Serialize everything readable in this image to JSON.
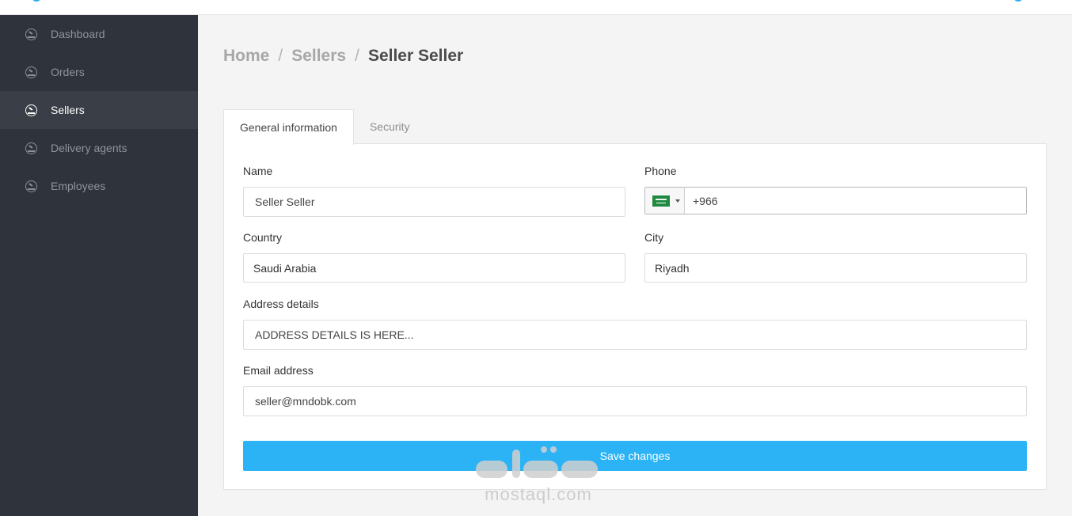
{
  "sidebar": {
    "items": [
      {
        "label": "Dashboard",
        "active": false
      },
      {
        "label": "Orders",
        "active": false
      },
      {
        "label": "Sellers",
        "active": true
      },
      {
        "label": "Delivery agents",
        "active": false
      },
      {
        "label": "Employees",
        "active": false
      }
    ]
  },
  "breadcrumb": {
    "home": "Home",
    "sellers": "Sellers",
    "current": "Seller Seller",
    "separator": "/"
  },
  "tabs": [
    {
      "label": "General information",
      "active": true
    },
    {
      "label": "Security",
      "active": false
    }
  ],
  "form": {
    "name": {
      "label": "Name",
      "value": "Seller Seller"
    },
    "phone": {
      "label": "Phone",
      "value": "+966",
      "country_flag": "saudi-arabia-flag"
    },
    "country": {
      "label": "Country",
      "value": "Saudi Arabia"
    },
    "city": {
      "label": "City",
      "value": "Riyadh"
    },
    "address": {
      "label": "Address details",
      "value": "ADDRESS DETAILS IS HERE..."
    },
    "email": {
      "label": "Email address",
      "value": "seller@mndobk.com"
    },
    "save_label": "Save changes"
  },
  "watermark": {
    "text": "mostaql.com"
  },
  "colors": {
    "sidebar_bg": "#2f333b",
    "accent": "#2bb3f5",
    "page_bg": "#f4f4f4"
  }
}
